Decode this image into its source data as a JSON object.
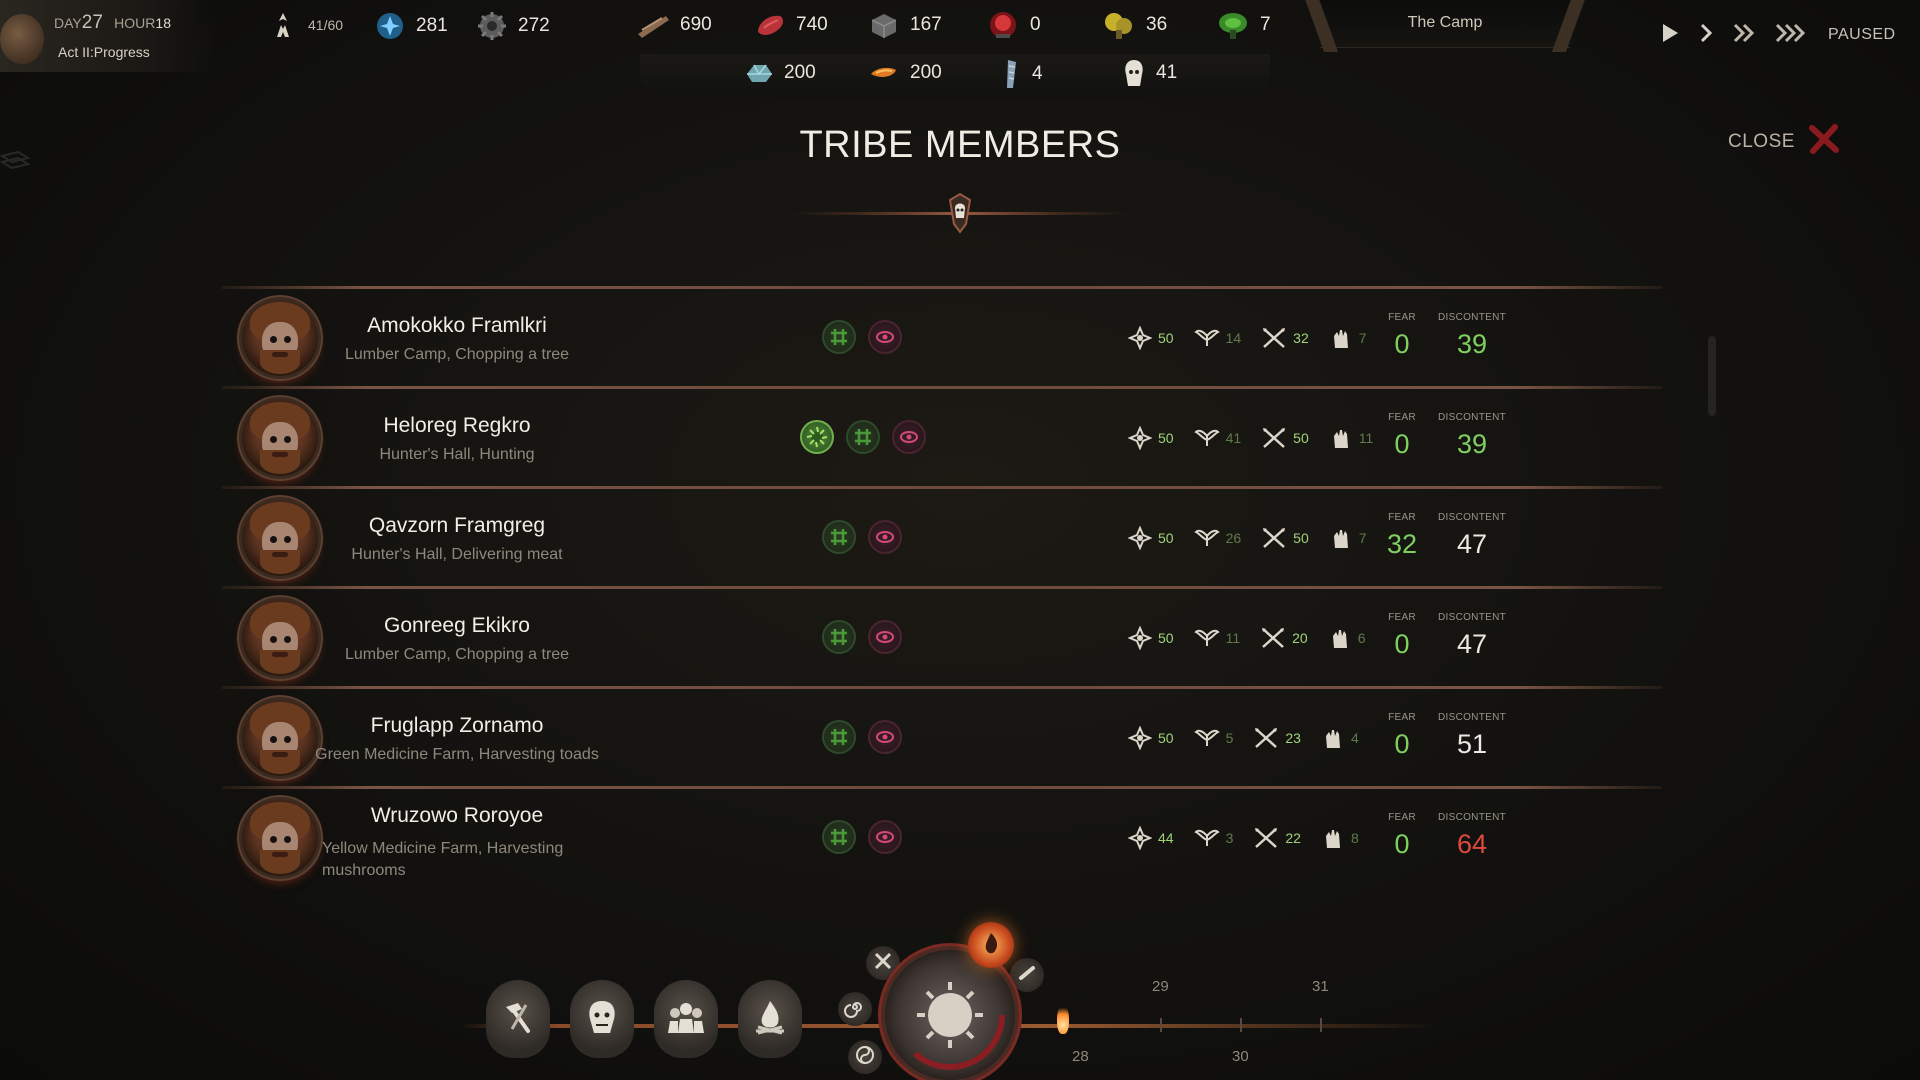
{
  "hud": {
    "day_label": "DAY",
    "day_value": "27",
    "hour_label": "HOUR",
    "hour_value": "18",
    "act": "Act II:Progress",
    "population": "41",
    "population_max": "/60",
    "resources_top": [
      {
        "icon": "spirit-icon",
        "value": "281"
      },
      {
        "icon": "gear-icon",
        "value": "272"
      },
      {
        "icon": "wood-icon",
        "value": "690"
      },
      {
        "icon": "meat-icon",
        "value": "740"
      },
      {
        "icon": "stone-icon",
        "value": "167"
      },
      {
        "icon": "red-orb-icon",
        "value": "0"
      },
      {
        "icon": "yellow-mushroom-icon",
        "value": "36"
      },
      {
        "icon": "green-herb-icon",
        "value": "7"
      }
    ],
    "resources_sub": [
      {
        "icon": "crystal-icon",
        "value": "200"
      },
      {
        "icon": "fire-stick-icon",
        "value": "200"
      },
      {
        "icon": "bone-tool-icon",
        "value": "4"
      },
      {
        "icon": "skull-icon",
        "value": "41"
      }
    ],
    "location": "The Camp",
    "speed_state": "PAUSED"
  },
  "panel": {
    "title": "TRIBE MEMBERS",
    "close_label": "CLOSE"
  },
  "labels": {
    "fear": "FEAR",
    "discontent": "DISCONTENT"
  },
  "members": [
    {
      "name": "Amokokko Framlkri",
      "job": "Lumber Camp, Chopping a tree",
      "traits": [
        "green-glyph",
        "pink-eye"
      ],
      "stats": [
        "50",
        "14",
        "32",
        "7"
      ],
      "fear": "0",
      "discontent": "39"
    },
    {
      "name": "Heloreg Regkro",
      "job": "Hunter's Hall, Hunting",
      "traits": [
        "spiky-green",
        "green-glyph",
        "pink-eye"
      ],
      "stats": [
        "50",
        "41",
        "50",
        "11"
      ],
      "fear": "0",
      "discontent": "39"
    },
    {
      "name": "Qavzorn Framgreg",
      "job": "Hunter's Hall, Delivering meat",
      "traits": [
        "green-glyph",
        "pink-eye"
      ],
      "stats": [
        "50",
        "26",
        "50",
        "7"
      ],
      "fear": "32",
      "discontent": "47"
    },
    {
      "name": "Gonreeg Ekikro",
      "job": "Lumber Camp, Chopping a tree",
      "traits": [
        "green-glyph",
        "pink-eye"
      ],
      "stats": [
        "50",
        "11",
        "20",
        "6"
      ],
      "fear": "0",
      "discontent": "47"
    },
    {
      "name": "Fruglapp Zornamo",
      "job": "Green Medicine Farm, Harvesting toads",
      "traits": [
        "green-glyph",
        "pink-eye"
      ],
      "stats": [
        "50",
        "5",
        "23",
        "4"
      ],
      "fear": "0",
      "discontent": "51"
    },
    {
      "name": "Wruzowo Roroyoe",
      "job": "Yellow Medicine Farm, Harvesting mushrooms",
      "traits": [
        "green-glyph",
        "pink-eye"
      ],
      "stats": [
        "44",
        "3",
        "22",
        "8"
      ],
      "fear": "0",
      "discontent": "64"
    }
  ],
  "timeline": {
    "days_top": [
      "29",
      "31"
    ],
    "days_bottom": [
      "28",
      "30"
    ]
  },
  "colors": {
    "accent_green": "#7fd060",
    "accent_red": "#e04a3e",
    "divider": "#7a5444"
  }
}
